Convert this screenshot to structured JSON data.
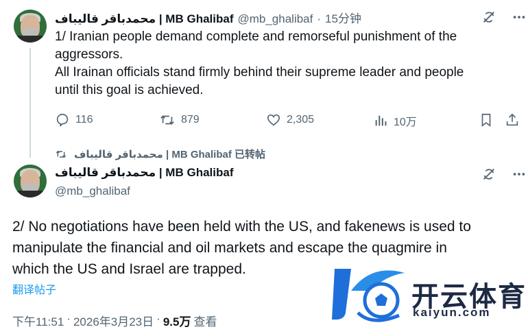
{
  "tweet1": {
    "name": "محمدباقر قالیباف | MB Ghalibaf",
    "handle": "@mb_ghalibaf",
    "dot": "·",
    "time": "15分钟",
    "lines": [
      "1/ Iranian people demand complete and remorseful punishment of the",
      "aggressors.",
      "All Irainan officials stand firmly behind their supreme leader and people",
      "until this goal is achieved."
    ],
    "stats": {
      "replies": "116",
      "retweets": "879",
      "likes": "2,305",
      "views": "10万"
    }
  },
  "retweet_note": "محمدباقر قالیباف | MB Ghalibaf 已转帖",
  "tweet2": {
    "name": "محمدباقر قالیباف | MB Ghalibaf",
    "handle": "@mb_ghalibaf",
    "lines": [
      "2/ No negotiations have been held with the US, and fakenews is used to",
      "manipulate the financial and oil markets and escape the quagmire in",
      "which the US and Israel are trapped."
    ],
    "translate": "翻译帖子",
    "footer": {
      "time": "下午11:51",
      "dot1": "·",
      "date": "2026年3月23日",
      "dot2": "·",
      "views": "9.5万",
      "views_label": "查看"
    }
  },
  "watermark": {
    "brand": "开云体育",
    "url": "kaiyun.com"
  },
  "colors": {
    "text": "#0f1419",
    "muted": "#536471",
    "link": "#1d9bf0",
    "thread_line": "#cfd9de",
    "brand_blue": "#1e6fd9"
  },
  "icons": [
    "grok-icon",
    "more-icon",
    "reply-icon",
    "retweet-icon",
    "like-icon",
    "views-icon",
    "bookmark-icon",
    "share-icon"
  ]
}
